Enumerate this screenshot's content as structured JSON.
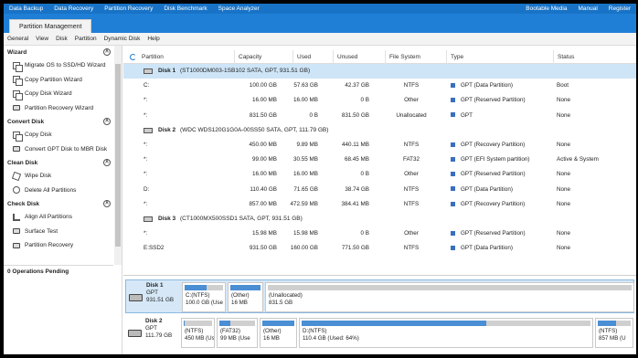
{
  "topnav": {
    "items": [
      "Data Backup",
      "Data Recovery",
      "Partition Recovery",
      "Disk Benchmark",
      "Space Analyzer"
    ],
    "right": [
      "Bootable Media",
      "Manual",
      "Register"
    ]
  },
  "tab": {
    "label": "Partition Management"
  },
  "menu": [
    "General",
    "View",
    "Disk",
    "Partition",
    "Dynamic Disk",
    "Help"
  ],
  "sidebar": {
    "sections": [
      {
        "title": "Wizard",
        "items": [
          "Migrate OS to SSD/HD Wizard",
          "Copy Partition Wizard",
          "Copy Disk Wizard",
          "Partition Recovery Wizard"
        ]
      },
      {
        "title": "Convert Disk",
        "items": [
          "Copy Disk",
          "Convert GPT Disk to MBR Disk"
        ]
      },
      {
        "title": "Clean Disk",
        "items": [
          "Wipe Disk",
          "Delete All Partitions"
        ]
      },
      {
        "title": "Check Disk",
        "items": [
          "Align All Partitions",
          "Surface Test",
          "Partition Recovery"
        ]
      }
    ],
    "pending": "0 Operations Pending"
  },
  "table": {
    "headers": [
      "Partition",
      "Capacity",
      "Used",
      "Unused",
      "File System",
      "Type",
      "Status"
    ],
    "rows": [
      {
        "kind": "disk",
        "selected": true,
        "label": "Disk 1",
        "detail": "(ST1000DM003-1SB102 SATA, GPT, 931.51 GB)"
      },
      {
        "kind": "part",
        "cells": [
          "C:",
          "100.00 GB",
          "57.63 GB",
          "42.37 GB",
          "NTFS",
          "GPT (Data Partition)",
          "Boot"
        ]
      },
      {
        "kind": "part",
        "cells": [
          "*:",
          "16.00 MB",
          "16.00 MB",
          "0 B",
          "Other",
          "GPT (Reserved Partition)",
          "None"
        ]
      },
      {
        "kind": "part",
        "cells": [
          "*:",
          "831.50 GB",
          "0 B",
          "831.50 GB",
          "Unallocated",
          "GPT",
          "None"
        ]
      },
      {
        "kind": "disk",
        "selected": false,
        "label": "Disk 2",
        "detail": "(WDC WDS120G1G0A-00SS50 SATA, GPT, 111.79 GB)"
      },
      {
        "kind": "part",
        "cells": [
          "*:",
          "450.00 MB",
          "9.89 MB",
          "440.11 MB",
          "NTFS",
          "GPT (Recovery Partition)",
          "None"
        ]
      },
      {
        "kind": "part",
        "cells": [
          "*:",
          "99.00 MB",
          "30.55 MB",
          "68.45 MB",
          "FAT32",
          "GPT (EFI System partition)",
          "Active & System"
        ]
      },
      {
        "kind": "part",
        "cells": [
          "*:",
          "16.00 MB",
          "16.00 MB",
          "0 B",
          "Other",
          "GPT (Reserved Partition)",
          "None"
        ]
      },
      {
        "kind": "part",
        "cells": [
          "D:",
          "110.40 GB",
          "71.65 GB",
          "38.74 GB",
          "NTFS",
          "GPT (Data Partition)",
          "None"
        ]
      },
      {
        "kind": "part",
        "cells": [
          "*:",
          "857.00 MB",
          "472.59 MB",
          "384.41 MB",
          "NTFS",
          "GPT (Recovery Partition)",
          "None"
        ]
      },
      {
        "kind": "disk",
        "selected": false,
        "label": "Disk 3",
        "detail": "(CT1000MX500SSD1 SATA, GPT, 931.51 GB)"
      },
      {
        "kind": "part",
        "cells": [
          "*:",
          "15.98 MB",
          "15.98 MB",
          "0 B",
          "Other",
          "GPT (Reserved Partition)",
          "None"
        ]
      },
      {
        "kind": "part",
        "cells": [
          "E:SSD2",
          "931.50 GB",
          "160.00 GB",
          "771.50 GB",
          "NTFS",
          "GPT (Data Partition)",
          "None"
        ]
      }
    ]
  },
  "diskmap": [
    {
      "name": "Disk 1",
      "style": "GPT",
      "size": "931.51 GB",
      "selected": true,
      "parts": [
        {
          "l1": "C:(NTFS)",
          "l2": "100.0 GB (Use",
          "used": 0.58
        },
        {
          "l1": "(Other)",
          "l2": "16 MB",
          "used": 1.0
        },
        {
          "l1": "(Unallocated)",
          "l2": "831.5 GB",
          "used": 0.0
        }
      ]
    },
    {
      "name": "Disk 2",
      "style": "GPT",
      "size": "111.79 GB",
      "selected": false,
      "parts": [
        {
          "l1": "(NTFS)",
          "l2": "450 MB (Us",
          "used": 0.02
        },
        {
          "l1": "(FAT32)",
          "l2": "99 MB (Use",
          "used": 0.31
        },
        {
          "l1": "(Other)",
          "l2": "16 MB",
          "used": 1.0
        },
        {
          "l1": "D:(NTFS)",
          "l2": "110.4 GB (Used: 64%)",
          "used": 0.64
        },
        {
          "l1": "(NTFS)",
          "l2": "857 MB (U",
          "used": 0.55
        }
      ]
    }
  ],
  "colors": {
    "nav": "#1873c7",
    "accent": "#1f7fd6",
    "selection": "#cde5f7",
    "used_fill": "#4a8ed4"
  }
}
